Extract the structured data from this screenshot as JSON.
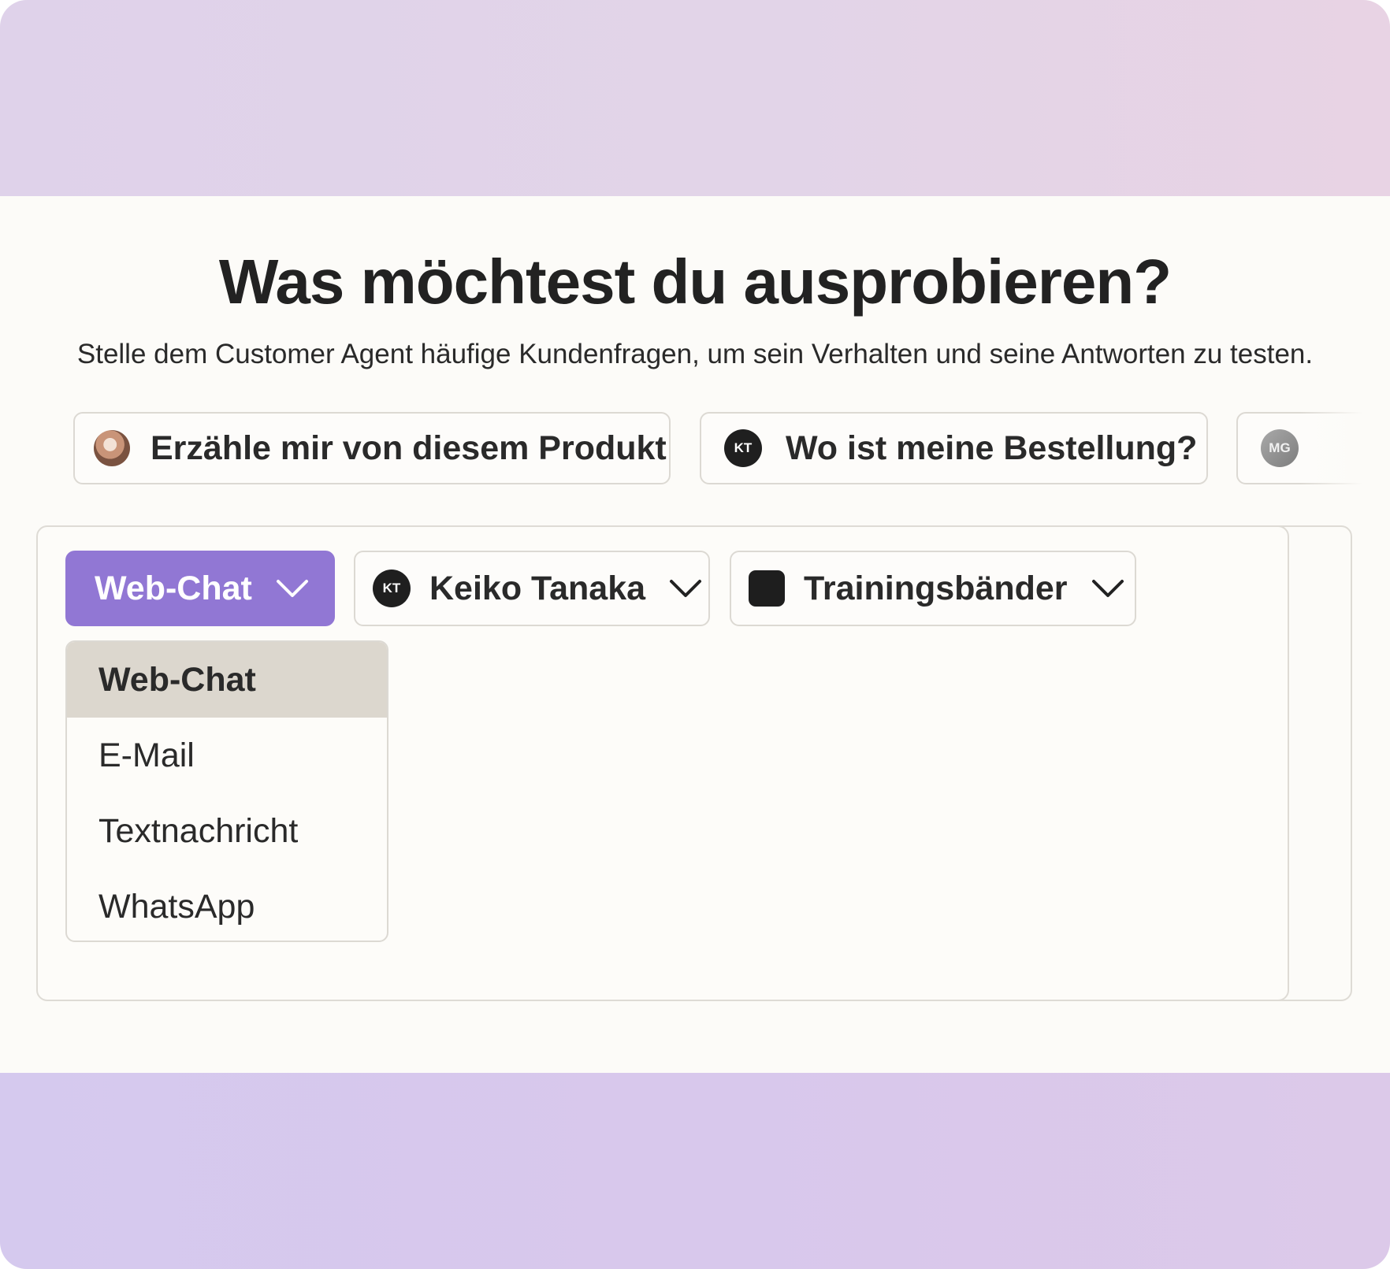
{
  "heading": "Was möchtest du ausprobieren?",
  "subheading": "Stelle dem Customer Agent häufige Kundenfragen, um sein Verhalten und seine Antworten zu testen.",
  "prompt_chips": [
    {
      "label": "Erzähle mir von diesem Produkt",
      "avatar": "photo"
    },
    {
      "label": "Wo ist meine Bestellung?",
      "avatar_initials": "KT"
    },
    {
      "label": "",
      "avatar_initials": "MG"
    }
  ],
  "controls": {
    "channel": {
      "selected": "Web-Chat",
      "accent": "#9177d4"
    },
    "customer": {
      "initials": "KT",
      "name": "Keiko Tanaka"
    },
    "product": {
      "name": "Trainingsbänder"
    }
  },
  "channel_menu": {
    "options": [
      "Web-Chat",
      "E-Mail",
      "Textnachricht",
      "WhatsApp"
    ],
    "selected_index": 0
  },
  "icons": {
    "dropdown": "chevron-down-icon",
    "product_swatch": "color-swatch-icon"
  }
}
